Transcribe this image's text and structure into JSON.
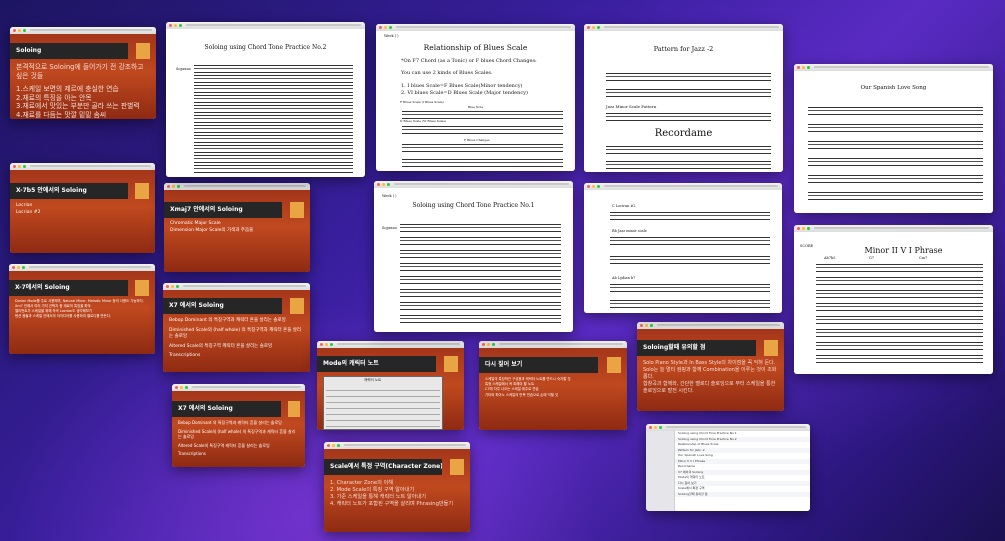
{
  "windows": {
    "soloing": {
      "title": "Soloing",
      "lines": [
        "본격적으로 Soloing에 들어가기 전 강조하고 싶은 것들",
        "1.스케일 보면의 제르에 충실한 연습",
        "2.재료의 특징을 아는 안목",
        "3.재료에서 맛있는 부분만 골라 쓰는 판별력",
        "4.재료를 다듬는 맛깔 밑밑 솜씨"
      ]
    },
    "x7b5": {
      "title": "X-7b5 안에서의 Soloing",
      "lines": [
        "Locrian",
        "Locrian #2"
      ]
    },
    "xmaj7": {
      "title": "Xmaj7 안에서의  Soloing",
      "lines": [
        "Chromatic Major Scale",
        "Dimension Major Scale의 가색과 주음을"
      ]
    },
    "xminor7": {
      "title": "X-7에서의 Soloing",
      "lines": [
        "Dorian Mode를 주로 사용하며, Natural Minor, Melodic Minor 등의 사용도 가능하다.",
        "Xm7 안에서 여러 가지 선택지 중 재료의 특징을 파악",
        "엘리먼트가 스케일을 위해 작곡 Locrian도 생각해보기",
        "텐션 음들과 스케일 안에서의 아이디어를 사용하여 멜로디를 만든다."
      ]
    },
    "x7a": {
      "title": "X7 에서의 Soloing",
      "lines": [
        "Bebop Dominant 의 특징구역과 캐릭터 흔을 살리는 솔로잉",
        "Diminished Scale의 (half whole) 의 특징구역과  캐릭터 흔을 살리는 솔로잉",
        "Altered Scale의 특징구역 캐릭터 흔을 살리는 솔로잉",
        "Transcriptions"
      ]
    },
    "x7b": {
      "title": "X7 에서의 Soloing",
      "lines": [
        "Bebop Dominant 의 특징구역과 캐릭터 흔을 살리는 솔로잉",
        "Diminished Scale의 (half whole) 의 특징구역과  캐릭터 흔을 살리는 솔로잉",
        "Altered Scale의 특징구역 캐릭터 흔을 살리는 솔로잉",
        "Transcriptions"
      ]
    },
    "mode": {
      "title": "Mode의 캐릭터 노트",
      "table_header": "캐릭터 노트"
    },
    "again": {
      "title": "다시 짚어 보기",
      "lines": [
        "스케일의 특징적인 구성음과 캐릭터 노트를 반드시 숙지할 것",
        "특정 스케일에서 꼭 피해야 할 노트",
        "C7에 자주 나오는 스케일 위주로 연습",
        "기타와 피아노 스케일의 반복 연습으로 손에 익힐 것"
      ]
    },
    "caution": {
      "title": "Soloing할때 유의할 점",
      "lines": [
        "Solo Piano Style과 In Bass Style의 차이점을 꼭 익혀 둔다.",
        "Solo는 늘 멀티 컴핑과 함께 Combination을 이루는 것이 조화롭다.",
        "합창곡과 함께와, 간단한 멜로디 솔로잉으로 부터 스케일을 통한 솔로잉으로 발전 시킨다."
      ]
    },
    "character": {
      "title": "Scale에서 특정 구역(Character Zone)이란?",
      "lines": [
        "1. Character Zone의 이해",
        "2. Mode Scale의 특징 구역 알아내기",
        "3. 기준 스케일을 통해 캐릭터 노트 알아내기",
        "4. 캐릭터 노트가 포함된 구역을 살리며 Phrasing만들기"
      ]
    },
    "score_ct2": {
      "title": "Soloing using Chord Tone Practice No.2",
      "label": "Soprano"
    },
    "blues": {
      "week": "Week (            )",
      "title": "Relationship of Blues Scale",
      "line1": "*On F7 Chord (as a Tonic) or F blues Chord Changes:",
      "line2": "You can use 2 kinds of Blues Scales.",
      "line3": "1. I blues Scale=F Blues Scale(Minor tendency)",
      "line4": "2. VI blues Scale=D Blues Scale (Major tendency)",
      "label_a": "F Blues Scale (I Blues Scale)",
      "label_b": "Blue Note",
      "label_c": "D Blues Scale (VI Blues Scale)",
      "label_d": "F Blues Changes"
    },
    "jazz2": {
      "title": "Pattern for Jazz -2",
      "sub1": "Jazz Minor Scale Pattern",
      "big": "Recordame"
    },
    "spanish": {
      "title": "Our Spanish Love Song"
    },
    "score_ct1": {
      "week": "Week (            )",
      "title": "Soloing using Chord Tone Practice No.1",
      "label": "Soprano"
    },
    "lydian": {
      "label1": "C Lociran #2",
      "label2": "Bb Jazz minor scale",
      "label3": "Ab Lydian b7"
    },
    "minor251": {
      "title": "Minor II V I Phrase",
      "score": "SCORE",
      "chords": [
        "Ab7b5",
        "G7",
        "Cm7"
      ]
    },
    "finder": {
      "rows": [
        "Soloing using Chord Tone Practice No.1",
        "Soloing using Chord Tone Practice No.2",
        "Relationship of Blues Scale",
        "Pattern for Jazz -2",
        "Our Spanish Love Song",
        "Minor II V I Phrase",
        "Recordame",
        "X7 에서의 Soloing",
        "Mode의 캐릭터 노트",
        "다시 짚어 보기",
        "Scale에서 특정 구역",
        "Soloing할때 유의할 점"
      ]
    }
  },
  "colors": {
    "slide_red": "#b13f1b",
    "slide_bar": "#262626",
    "slide_accent": "#e9a443"
  }
}
